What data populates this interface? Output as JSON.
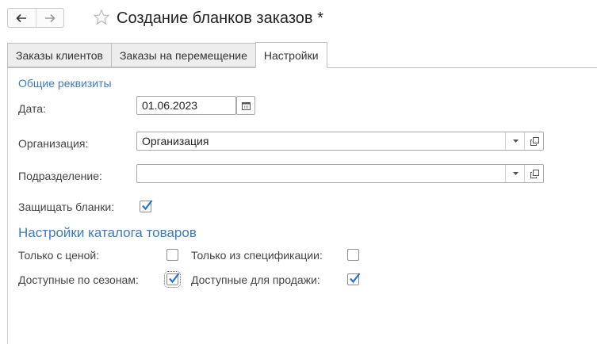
{
  "header": {
    "back_icon": "arrow-left-icon",
    "forward_icon": "arrow-right-icon",
    "favorite_icon": "star-icon",
    "title": "Создание бланков заказов *"
  },
  "tabs": [
    {
      "label": "Заказы клиентов",
      "active": false
    },
    {
      "label": "Заказы на перемещение",
      "active": false
    },
    {
      "label": "Настройки",
      "active": true
    }
  ],
  "general": {
    "group_title": "Общие реквизиты",
    "date_label": "Дата:",
    "date_value": "01.06.2023",
    "organization_label": "Организация:",
    "organization_value": "Организация",
    "department_label": "Подразделение:",
    "department_value": "",
    "protect_label": "Защищать бланки:",
    "protect_checked": true
  },
  "catalog": {
    "section_title": "Настройки каталога товаров",
    "price_only_label": "Только с ценой:",
    "price_only_checked": false,
    "spec_only_label": "Только из спецификации:",
    "spec_only_checked": false,
    "season_label": "Доступные по сезонам:",
    "season_checked": true,
    "sale_label": "Доступные для продажи:",
    "sale_checked": true
  },
  "colors": {
    "accent": "#3d7bbf",
    "check": "#2a73c5"
  }
}
